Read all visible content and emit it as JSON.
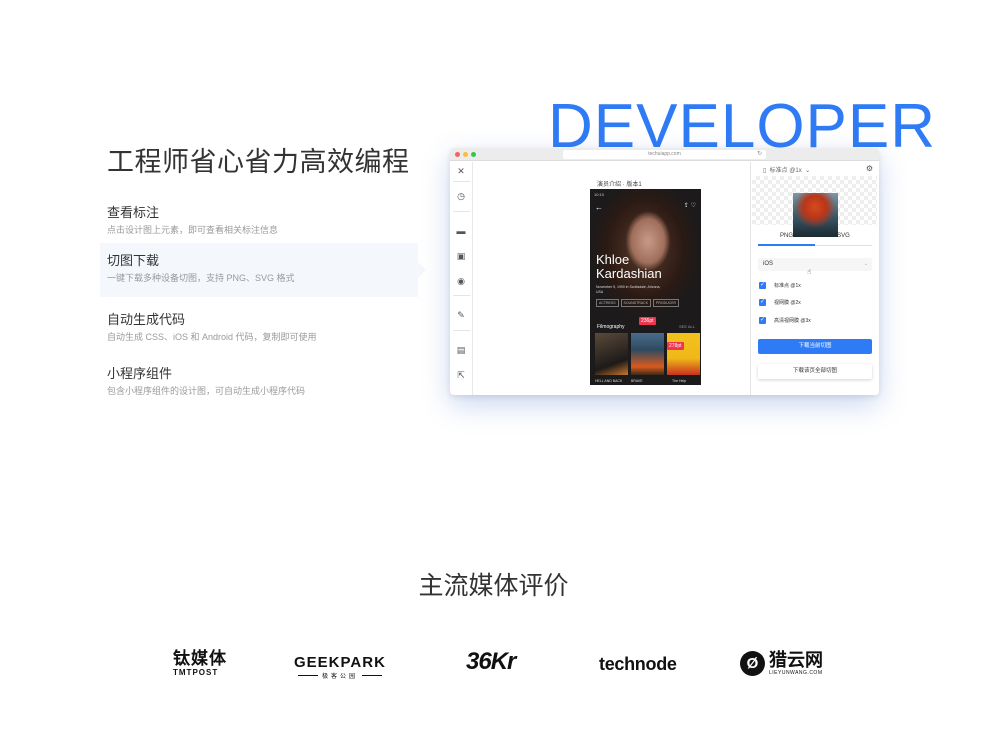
{
  "colors": {
    "accent": "#2f7bf5",
    "badge": "#f0334f",
    "active_feature_bg": "#f4f7fc"
  },
  "hero": {
    "title": "工程师省心省力高效编程",
    "watermark": "DEVELOPER"
  },
  "features": [
    {
      "title": "查看标注",
      "desc": "点击设计图上元素，即可查看相关标注信息",
      "active": false
    },
    {
      "title": "切图下载",
      "desc": "一键下载多种设备切图，支持 PNG、SVG 格式",
      "active": true
    },
    {
      "title": "自动生成代码",
      "desc": "自动生成 CSS、iOS 和 Android 代码，复制即可使用",
      "active": false
    },
    {
      "title": "小程序组件",
      "desc": "包含小程序组件的设计图，可自动生成小程序代码",
      "active": false
    }
  ],
  "window": {
    "url": "techuiapp.com",
    "artboard_label": "演员介绍 · 版本1",
    "sidebar_icons": [
      "close-icon",
      "clock-icon",
      "comment-icon",
      "add-comment-icon",
      "eye-icon",
      "brush-icon",
      "export-code-icon",
      "share-icon"
    ],
    "phone": {
      "status_time": "10:10",
      "name_line1": "Khloe",
      "name_line2": "Kardashian",
      "bio": "November 5, 1990 in Scottsdale, Arizona, USA",
      "tags": [
        "ACTRESS",
        "SOUNDTRACK",
        "PRODUCER"
      ],
      "films_title": "Filmography",
      "see_all": "SEE ALL",
      "posters": [
        "HELL AND BACK",
        "BRAVE",
        "The Help"
      ],
      "badges": [
        "236pt",
        "278pt"
      ]
    },
    "panel": {
      "header": "标准点 @1x",
      "tabs": [
        "PNG",
        "SVG"
      ],
      "active_tab": "PNG",
      "platform": "iOS",
      "options": [
        "标准点 @1x",
        "视网膜 @2x",
        "高清视网膜 @3x"
      ],
      "download_current": "下载当前切图",
      "download_all": "下载该页全部切图"
    }
  },
  "media": {
    "title": "主流媒体评价",
    "logos": {
      "tmtpost_cn": "钛媒体",
      "tmtpost_en": "TMTPOST",
      "geekpark_en": "GEEKPARK",
      "geekpark_cn": "极客公园",
      "kr36": "36Kr",
      "technode": "technode",
      "lieyun_cn": "猎云网",
      "lieyun_en": "LIEYUNWANG.COM"
    }
  }
}
